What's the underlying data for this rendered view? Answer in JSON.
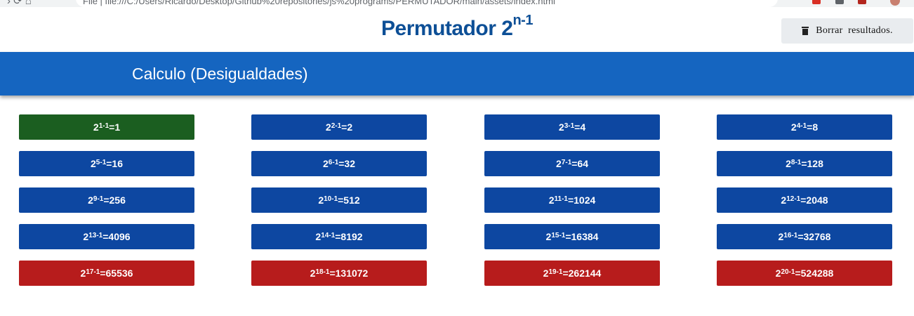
{
  "browser": {
    "url": "File | file:///C:/Users/Ricardo/Desktop/Github%20repositories/js%20programs/PERMUTADOR/main/assets/index.html"
  },
  "header": {
    "title_base": "Permutador 2",
    "title_exp": "n-1",
    "clear_button_label": "Borrar  resultados."
  },
  "banner": {
    "text": "Calculo (Desigualdades)"
  },
  "results": [
    {
      "base": "2",
      "exp": "1-1",
      "value": "=1",
      "status": "green"
    },
    {
      "base": "2",
      "exp": "2-1",
      "value": "=2",
      "status": "blue"
    },
    {
      "base": "2",
      "exp": "3-1",
      "value": "=4",
      "status": "blue"
    },
    {
      "base": "2",
      "exp": "4-1",
      "value": "=8",
      "status": "blue"
    },
    {
      "base": "2",
      "exp": "5-1",
      "value": "=16",
      "status": "blue"
    },
    {
      "base": "2",
      "exp": "6-1",
      "value": "=32",
      "status": "blue"
    },
    {
      "base": "2",
      "exp": "7-1",
      "value": "=64",
      "status": "blue"
    },
    {
      "base": "2",
      "exp": "8-1",
      "value": "=128",
      "status": "blue"
    },
    {
      "base": "2",
      "exp": "9-1",
      "value": "=256",
      "status": "blue"
    },
    {
      "base": "2",
      "exp": "10-1",
      "value": "=512",
      "status": "blue"
    },
    {
      "base": "2",
      "exp": "11-1",
      "value": "=1024",
      "status": "blue"
    },
    {
      "base": "2",
      "exp": "12-1",
      "value": "=2048",
      "status": "blue"
    },
    {
      "base": "2",
      "exp": "13-1",
      "value": "=4096",
      "status": "blue"
    },
    {
      "base": "2",
      "exp": "14-1",
      "value": "=8192",
      "status": "blue"
    },
    {
      "base": "2",
      "exp": "15-1",
      "value": "=16384",
      "status": "blue"
    },
    {
      "base": "2",
      "exp": "16-1",
      "value": "=32768",
      "status": "blue"
    },
    {
      "base": "2",
      "exp": "17-1",
      "value": "=65536",
      "status": "red"
    },
    {
      "base": "2",
      "exp": "18-1",
      "value": "=131072",
      "status": "red"
    },
    {
      "base": "2",
      "exp": "19-1",
      "value": "=262144",
      "status": "red"
    },
    {
      "base": "2",
      "exp": "20-1",
      "value": "=524288",
      "status": "red"
    }
  ],
  "colors": {
    "green": "#1b5e20",
    "blue": "#0d47a1",
    "red": "#b71c1c",
    "banner": "#1565c0",
    "title": "#0d4f96"
  }
}
